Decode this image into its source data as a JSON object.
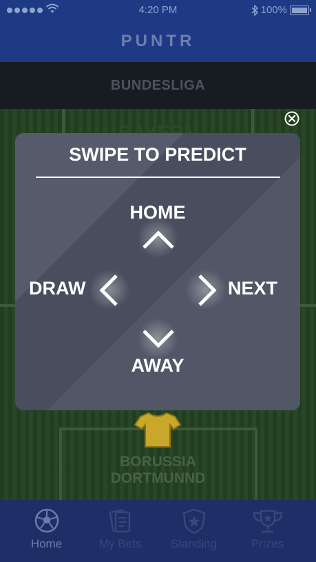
{
  "status_bar": {
    "time": "4:20 PM",
    "battery": "100%"
  },
  "header": {
    "logo": "PUNTR"
  },
  "league": {
    "name": "BUNDESLIGA"
  },
  "match": {
    "home_team": "BAYERN",
    "away_team_line1": "BORUSSIA",
    "away_team_line2": "DORTMUNND"
  },
  "modal": {
    "title": "SWIPE TO PREDICT",
    "up_label": "HOME",
    "left_label": "DRAW",
    "right_label": "NEXT",
    "down_label": "AWAY"
  },
  "tabs": [
    {
      "label": "Home",
      "icon": "soccer-ball-icon",
      "active": true
    },
    {
      "label": "My Bets",
      "icon": "cards-icon",
      "active": false
    },
    {
      "label": "Standing",
      "icon": "shield-star-icon",
      "active": false
    },
    {
      "label": "Prizes",
      "icon": "trophy-icon",
      "active": false
    }
  ],
  "colors": {
    "status_bar_bg": "#1f3a85",
    "tab_bar_bg": "#1d2f66",
    "modal_bg": "#4c5262",
    "pitch": "#22401f",
    "jersey": "#c9a72a"
  }
}
